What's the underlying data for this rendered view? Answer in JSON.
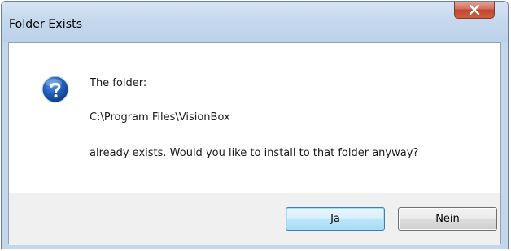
{
  "window": {
    "title": "Folder Exists"
  },
  "message": {
    "line1": "The folder:",
    "line2": "C:\\Program Files\\VisionBox",
    "line3": "already exists. Would you like to install to that folder anyway?"
  },
  "buttons": {
    "yes_label": "Ja",
    "no_label": "Nein"
  },
  "icons": {
    "dialog_icon": "question-icon",
    "close": "close-icon"
  },
  "colors": {
    "accent": "#3c7fb1",
    "close_button": "#c24532"
  }
}
